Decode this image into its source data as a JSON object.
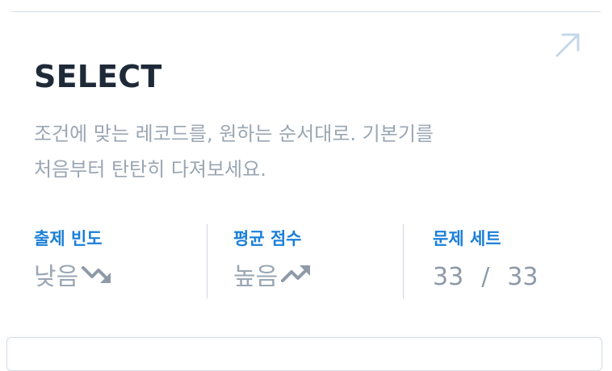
{
  "card": {
    "title": "SELECT",
    "description_line1": "조건에 맞는 레코드를, 원하는 순서대로. 기본기를",
    "description_line2": "처음부터 탄탄히 다져보세요.",
    "open_icon": "arrow-up-right-icon"
  },
  "stats": {
    "frequency": {
      "label": "출제 빈도",
      "value": "낮음",
      "icon": "trending-down-icon"
    },
    "average_score": {
      "label": "평균 점수",
      "value": "높음",
      "icon": "trending-up-icon"
    },
    "problem_sets": {
      "label": "문제 세트",
      "solved": "33",
      "separator": "/",
      "total": "33"
    }
  },
  "colors": {
    "title": "#1e2a38",
    "muted": "#9aa6b3",
    "accent": "#1a7fd8",
    "icon_light": "#c5d8ea",
    "divider": "#cfd8e1"
  }
}
